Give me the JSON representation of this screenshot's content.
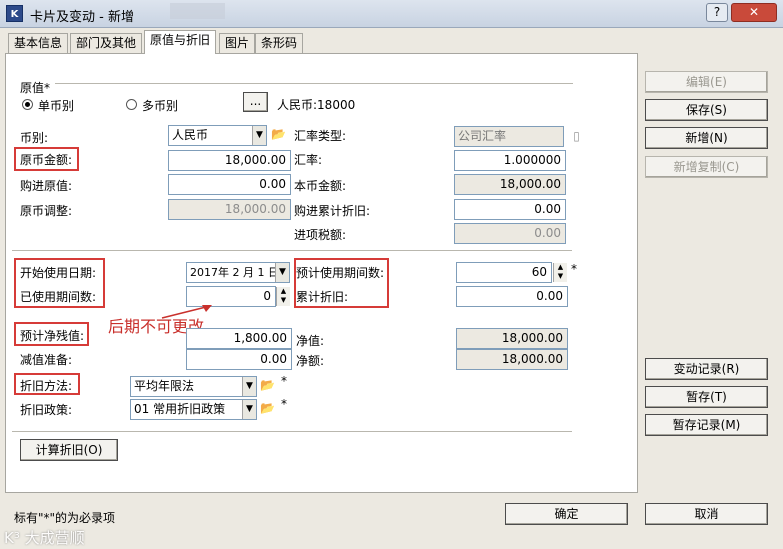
{
  "window": {
    "title": "卡片及变动 - 新增",
    "app_icon": "k3-app-icon",
    "help": "?",
    "close": "✕"
  },
  "tabs": [
    "基本信息",
    "部门及其他",
    "原值与折旧",
    "图片",
    "条形码"
  ],
  "active_tab": 2,
  "section": {
    "original_value_heading": "原值*",
    "single_currency": "单币别",
    "multi_currency": "多币别",
    "ellipsis": "...",
    "currency_summary": "人民币:18000"
  },
  "left": {
    "currency_label": "币别:",
    "currency_value": "人民币",
    "orig_amount_label": "原币金额:",
    "orig_amount_value": "18,000.00",
    "purchase_label": "购进原值:",
    "purchase_value": "0.00",
    "adjust_label": "原币调整:",
    "adjust_value": "18,000.00"
  },
  "right": {
    "rate_type_label": "汇率类型:",
    "rate_type_value": "公司汇率",
    "rate_label": "汇率:",
    "rate_value": "1.000000",
    "local_amount_label": "本币金额:",
    "local_amount_value": "18,000.00",
    "purchase_depr_label": "购进累计折旧:",
    "purchase_depr_value": "0.00",
    "input_tax_label": "进项税额:",
    "input_tax_value": "0.00"
  },
  "usage": {
    "start_date_label": "开始使用日期:",
    "start_date_value": "2017年 2 月 1 日",
    "used_periods_label": "已使用期间数:",
    "used_periods_value": "0",
    "expected_periods_label": "预计使用期间数:",
    "expected_periods_value": "60",
    "accum_depr_label": "累计折旧:",
    "accum_depr_value": "0.00",
    "required_mark": "*"
  },
  "annotation": "后期不可更改",
  "residual": {
    "residual_label": "预计净残值:",
    "residual_value": "1,800.00",
    "impairment_label": "减值准备:",
    "impairment_value": "0.00",
    "net_value_label": "净值:",
    "net_value_value": "18,000.00",
    "net_amount_label": "净额:",
    "net_amount_value": "18,000.00"
  },
  "depreciation": {
    "method_label": "折旧方法:",
    "method_value": "平均年限法",
    "policy_label": "折旧政策:",
    "policy_value": "01",
    "policy_name": "常用折旧政策",
    "required_mark": "*"
  },
  "calc_button": "计算折旧(O)",
  "footer": {
    "note": "标有\"*\"的为必录项",
    "ok": "确定",
    "cancel": "取消",
    "watermark": "K³ 大成营顺"
  },
  "side_buttons": {
    "edit": "编辑(E)",
    "save": "保存(S)",
    "new": "新增(N)",
    "new_copy": "新增复制(C)",
    "change_log": "变动记录(R)",
    "hold": "暂存(T)",
    "hold_log": "暂存记录(M)"
  },
  "colors": {
    "highlight": "#d63b38",
    "annotation": "#c9302c"
  }
}
